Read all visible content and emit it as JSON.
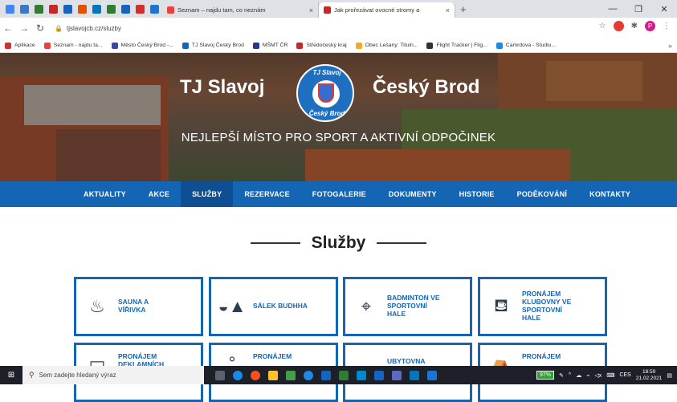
{
  "browser": {
    "tabs": [
      {
        "title": "Seznam – najdu tam, co neznám",
        "color": "#e7423b"
      },
      {
        "title": "Jak prořezávat ovocné stromy a",
        "color": "#c62828"
      }
    ],
    "pinned_colors": [
      "#4285f4",
      "#3a78c8",
      "#2e7d32",
      "#c62828",
      "#1565c0",
      "#e65100",
      "#0277bd",
      "#2e7d32",
      "#1565c0",
      "#d32f2f",
      "#1976d2"
    ],
    "new_tab_icon": "+",
    "url": "tjslavojcb.cz/sluzby",
    "bookmarks": [
      {
        "label": "Aplikace",
        "color": "#d32f2f"
      },
      {
        "label": "Seznam - najdu ta...",
        "color": "#e7423b"
      },
      {
        "label": "Město Český Brod -...",
        "color": "#3949ab"
      },
      {
        "label": "TJ Slavoj Český Brod",
        "color": "#1565c0"
      },
      {
        "label": "MŠMT ČR",
        "color": "#283593"
      },
      {
        "label": "Středočeský kraj",
        "color": "#c62828"
      },
      {
        "label": "Obec Lešany: Tituln...",
        "color": "#f9a825"
      },
      {
        "label": "Flight Tracker | Flig...",
        "color": "#333333"
      },
      {
        "label": "Camrdova - Studiu...",
        "color": "#1e88e5"
      }
    ],
    "more_bookmarks": "»",
    "profile_initial": "P"
  },
  "hero": {
    "title_left": "TJ Slavoj",
    "title_right": "Český Brod",
    "logo_top": "TJ Slavoj",
    "logo_bottom": "Český Brod",
    "subtitle": "NEJLEPŠÍ MÍSTO PRO SPORT A AKTIVNÍ ODPOČINEK"
  },
  "menu": {
    "items": [
      "AKTUALITY",
      "AKCE",
      "SLUŽBY",
      "REZERVACE",
      "FOTOGALERIE",
      "DOKUMENTY",
      "HISTORIE",
      "PODĚKOVÁNÍ",
      "KONTAKTY"
    ],
    "active": "SLUŽBY"
  },
  "page": {
    "heading": "Služby"
  },
  "services": [
    {
      "label": "SAUNA A\nVÍŘIVKA",
      "icon": "sauna-icon"
    },
    {
      "label": "SÁLEK BUDHHA",
      "icon": "yoga-icon"
    },
    {
      "label": "BADMINTON VE\nSPORTOVNÍ\nHALE",
      "icon": "shuttlecock-icon"
    },
    {
      "label": "PRONÁJEM\nKLUBOVNY VE\nSPORTOVNÍ\nHALE",
      "icon": "sofa-icon"
    },
    {
      "label": "PRONÁJEM\nDEKLAMNÍCH",
      "icon": "board-icon"
    },
    {
      "label": "PRONÁJEM",
      "icon": "key-icon"
    },
    {
      "label": "UBYTOVNA",
      "icon": "bed-icon"
    },
    {
      "label": "PRONÁJEM",
      "icon": "tent-icon"
    }
  ],
  "taskbar": {
    "search_placeholder": "Sem zadejte hledaný výraz",
    "battery": "97%",
    "language": "CES",
    "time": "18:59",
    "date": "21.02.2021"
  }
}
